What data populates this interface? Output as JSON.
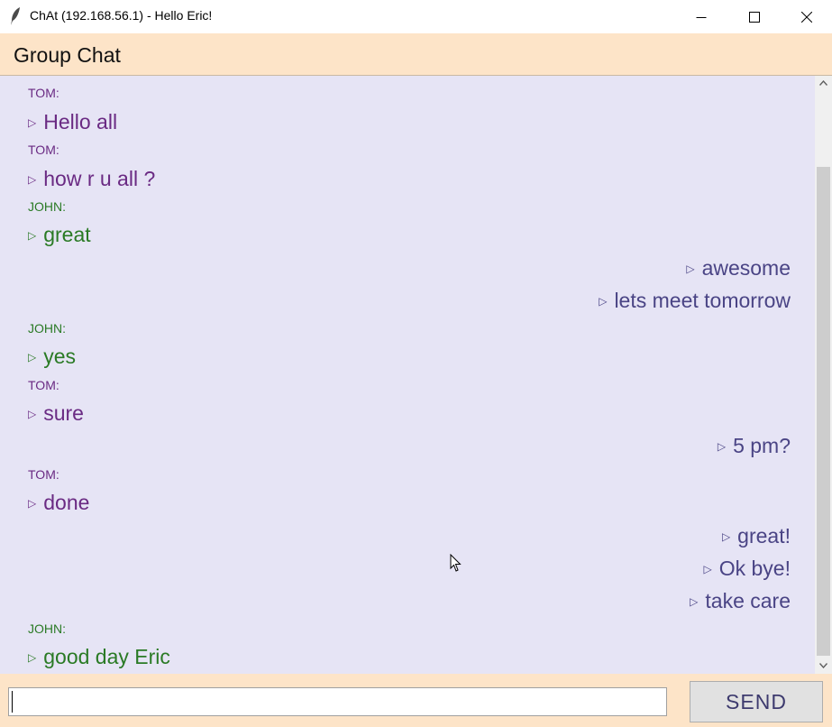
{
  "window": {
    "title": "ChAt (192.168.56.1) - Hello Eric!",
    "icon": "feather-icon"
  },
  "header": {
    "title": "Group Chat"
  },
  "messages": [
    {
      "sender": "TOM:",
      "text": "Hello all",
      "side": "left",
      "who": "tom"
    },
    {
      "sender": "TOM:",
      "text": "how r u all ?",
      "side": "left",
      "who": "tom"
    },
    {
      "sender": "JOHN:",
      "text": "great",
      "side": "left",
      "who": "john"
    },
    {
      "sender": "",
      "text": "awesome",
      "side": "right",
      "who": "me"
    },
    {
      "sender": "",
      "text": "lets meet tomorrow",
      "side": "right",
      "who": "me"
    },
    {
      "sender": "JOHN:",
      "text": "yes",
      "side": "left",
      "who": "john"
    },
    {
      "sender": "TOM:",
      "text": "sure",
      "side": "left",
      "who": "tom"
    },
    {
      "sender": "",
      "text": "5 pm?",
      "side": "right",
      "who": "me"
    },
    {
      "sender": "TOM:",
      "text": "done",
      "side": "left",
      "who": "tom"
    },
    {
      "sender": "",
      "text": "great!",
      "side": "right",
      "who": "me"
    },
    {
      "sender": "",
      "text": "Ok bye!",
      "side": "right",
      "who": "me"
    },
    {
      "sender": "",
      "text": "take care",
      "side": "right",
      "who": "me"
    },
    {
      "sender": "JOHN:",
      "text": "good day Eric",
      "side": "left",
      "who": "john"
    }
  ],
  "bullet": "▷",
  "input": {
    "value": "",
    "placeholder": ""
  },
  "send_label": "SEND",
  "colors": {
    "header_bg": "#fde4c8",
    "chat_bg": "#e6e4f5",
    "tom": "#6a2a83",
    "john": "#2a7a25",
    "me": "#4a4485"
  }
}
